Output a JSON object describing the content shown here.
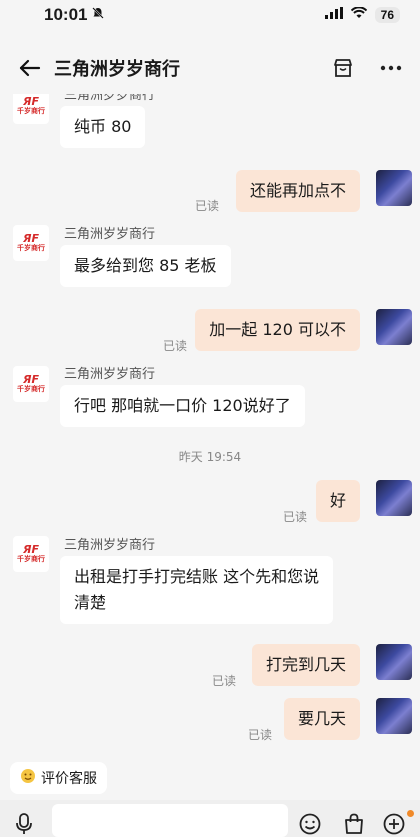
{
  "status_bar": {
    "time": "10:01",
    "battery": "76"
  },
  "header": {
    "title": "三角洲岁岁商行"
  },
  "shop": {
    "logo_mark": "ЯF",
    "logo_text": "千岁商行"
  },
  "messages": [
    {
      "from": "shop",
      "sender": "三角洲岁岁商行",
      "text": "纯币 80"
    },
    {
      "from": "me",
      "text": "还能再加点不",
      "read": "已读"
    },
    {
      "from": "shop",
      "sender": "三角洲岁岁商行",
      "text": "最多给到您 85 老板"
    },
    {
      "from": "me",
      "text": "加一起 120 可以不",
      "read": "已读"
    },
    {
      "from": "shop",
      "sender": "三角洲岁岁商行",
      "text": "行吧 那咱就一口价 120说好了"
    },
    {
      "from": "me",
      "text": "好",
      "read": "已读"
    },
    {
      "from": "shop",
      "sender": "三角洲岁岁商行",
      "text_line1": "出租是打手打完结账 这个先和您说",
      "text_line2": "清楚"
    },
    {
      "from": "me",
      "text": "打完到几天",
      "read": "已读"
    },
    {
      "from": "me",
      "text": "要几天",
      "read": "已读"
    }
  ],
  "time_separator": "昨天 19:54",
  "quick_action": {
    "label": "评价客服"
  },
  "icons": [
    "back-arrow-icon",
    "shop-icon",
    "more-icon",
    "voice-icon",
    "emoji-icon",
    "bag-icon",
    "plus-icon",
    "bell-muted-icon",
    "signal-icon",
    "wifi-icon"
  ]
}
